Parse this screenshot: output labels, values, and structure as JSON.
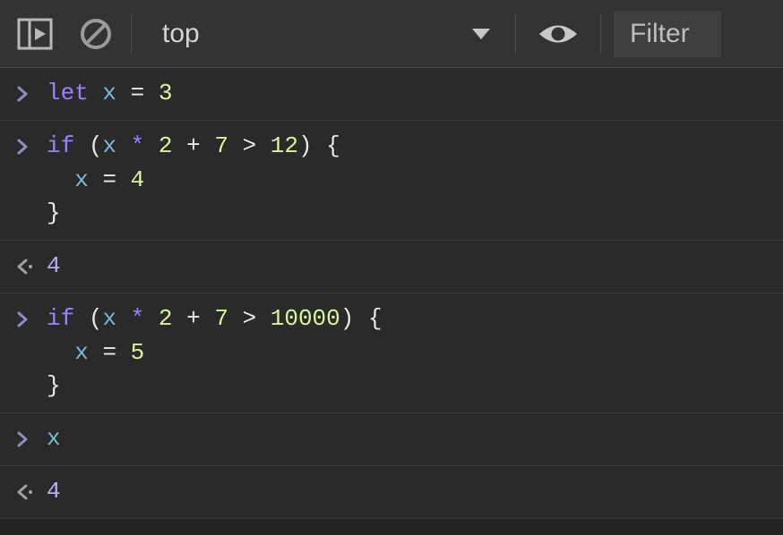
{
  "toolbar": {
    "context": "top",
    "filter_placeholder": "Filter"
  },
  "console": {
    "entries": [
      {
        "type": "input",
        "tokens": [
          {
            "t": "let",
            "c": "keyword"
          },
          {
            "t": " ",
            "c": "op"
          },
          {
            "t": "x",
            "c": "var"
          },
          {
            "t": " ",
            "c": "op"
          },
          {
            "t": "=",
            "c": "op"
          },
          {
            "t": " ",
            "c": "op"
          },
          {
            "t": "3",
            "c": "num"
          }
        ]
      },
      {
        "type": "input",
        "tokens": [
          {
            "t": "if",
            "c": "keyword"
          },
          {
            "t": " (",
            "c": "punc"
          },
          {
            "t": "x",
            "c": "var"
          },
          {
            "t": " ",
            "c": "op"
          },
          {
            "t": "*",
            "c": "keyword"
          },
          {
            "t": " ",
            "c": "op"
          },
          {
            "t": "2",
            "c": "num"
          },
          {
            "t": " ",
            "c": "op"
          },
          {
            "t": "+",
            "c": "op"
          },
          {
            "t": " ",
            "c": "op"
          },
          {
            "t": "7",
            "c": "num"
          },
          {
            "t": " ",
            "c": "op"
          },
          {
            "t": ">",
            "c": "op"
          },
          {
            "t": " ",
            "c": "op"
          },
          {
            "t": "12",
            "c": "num"
          },
          {
            "t": ") {",
            "c": "punc"
          },
          {
            "t": "\n  ",
            "c": "op"
          },
          {
            "t": "x",
            "c": "var"
          },
          {
            "t": " ",
            "c": "op"
          },
          {
            "t": "=",
            "c": "op"
          },
          {
            "t": " ",
            "c": "op"
          },
          {
            "t": "4",
            "c": "num"
          },
          {
            "t": "\n}",
            "c": "punc"
          }
        ]
      },
      {
        "type": "output",
        "tokens": [
          {
            "t": "4",
            "c": "result"
          }
        ]
      },
      {
        "type": "input",
        "tokens": [
          {
            "t": "if",
            "c": "keyword"
          },
          {
            "t": " (",
            "c": "punc"
          },
          {
            "t": "x",
            "c": "var"
          },
          {
            "t": " ",
            "c": "op"
          },
          {
            "t": "*",
            "c": "keyword"
          },
          {
            "t": " ",
            "c": "op"
          },
          {
            "t": "2",
            "c": "num"
          },
          {
            "t": " ",
            "c": "op"
          },
          {
            "t": "+",
            "c": "op"
          },
          {
            "t": " ",
            "c": "op"
          },
          {
            "t": "7",
            "c": "num"
          },
          {
            "t": " ",
            "c": "op"
          },
          {
            "t": ">",
            "c": "op"
          },
          {
            "t": " ",
            "c": "op"
          },
          {
            "t": "10000",
            "c": "num"
          },
          {
            "t": ") {",
            "c": "punc"
          },
          {
            "t": "\n  ",
            "c": "op"
          },
          {
            "t": "x",
            "c": "var"
          },
          {
            "t": " ",
            "c": "op"
          },
          {
            "t": "=",
            "c": "op"
          },
          {
            "t": " ",
            "c": "op"
          },
          {
            "t": "5",
            "c": "num"
          },
          {
            "t": "\n}",
            "c": "punc"
          }
        ]
      },
      {
        "type": "input",
        "tokens": [
          {
            "t": "x",
            "c": "var"
          }
        ]
      },
      {
        "type": "output",
        "tokens": [
          {
            "t": "4",
            "c": "result"
          }
        ]
      }
    ]
  }
}
